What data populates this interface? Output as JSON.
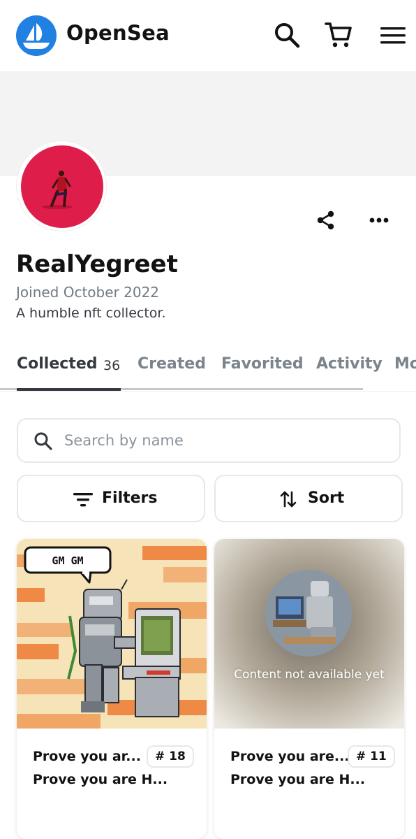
{
  "header": {
    "brand": "OpenSea",
    "icons": [
      "search-icon",
      "cart-icon",
      "menu-icon"
    ]
  },
  "profile": {
    "username": "RealYegreet",
    "joined": "Joined October 2022",
    "bio": "A humble nft collector.",
    "actions": [
      "share-icon",
      "more-icon"
    ]
  },
  "tabs": [
    {
      "label": "Collected",
      "count": "36"
    },
    {
      "label": "Created"
    },
    {
      "label": "Favorited"
    },
    {
      "label": "Activity"
    },
    {
      "label": "Mo"
    }
  ],
  "search": {
    "placeholder": "Search by name",
    "value": ""
  },
  "controls": {
    "filters_label": "Filters",
    "sort_label": "Sort"
  },
  "cards": [
    {
      "speech": "GM GM",
      "title": "Prove you ar...",
      "subtitle": "Prove you are H...",
      "number": "# 18"
    },
    {
      "overlay": "Content not available yet",
      "title": "Prove you are...",
      "subtitle": "Prove you are H...",
      "number": "# 11"
    }
  ],
  "colors": {
    "brand": "#2081e2",
    "avatar_bg": "#df1d4b",
    "text": "#121212",
    "muted": "#707a83"
  }
}
